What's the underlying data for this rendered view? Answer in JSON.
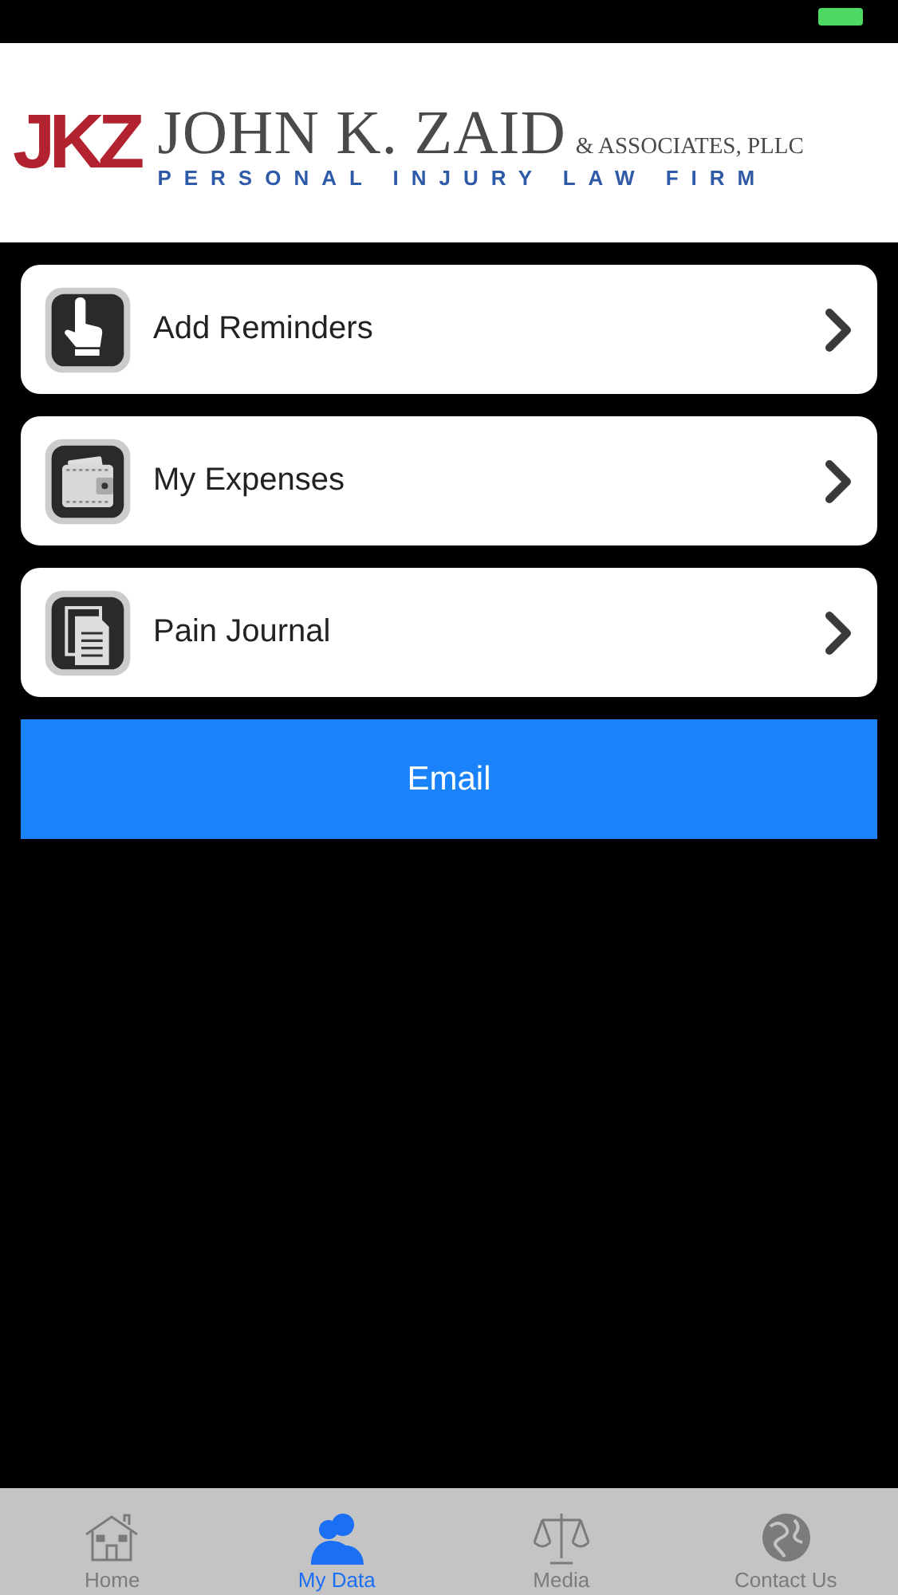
{
  "logo": {
    "monogram": "JKZ",
    "name": "JOHN K. ZAID",
    "suffix": "& ASSOCIATES, PLLC",
    "tagline": "PERSONAL INJURY LAW FIRM"
  },
  "menu": [
    {
      "label": "Add Reminders",
      "kind": "reminder"
    },
    {
      "label": "My Expenses",
      "kind": "wallet"
    },
    {
      "label": "Pain Journal",
      "kind": "journal"
    }
  ],
  "email_button": "Email",
  "tabs": [
    {
      "label": "Home",
      "kind": "house",
      "selected": false
    },
    {
      "label": "My Data",
      "kind": "people",
      "selected": true
    },
    {
      "label": "Media",
      "kind": "scales",
      "selected": false
    },
    {
      "label": "Contact Us",
      "kind": "globe",
      "selected": false
    }
  ]
}
